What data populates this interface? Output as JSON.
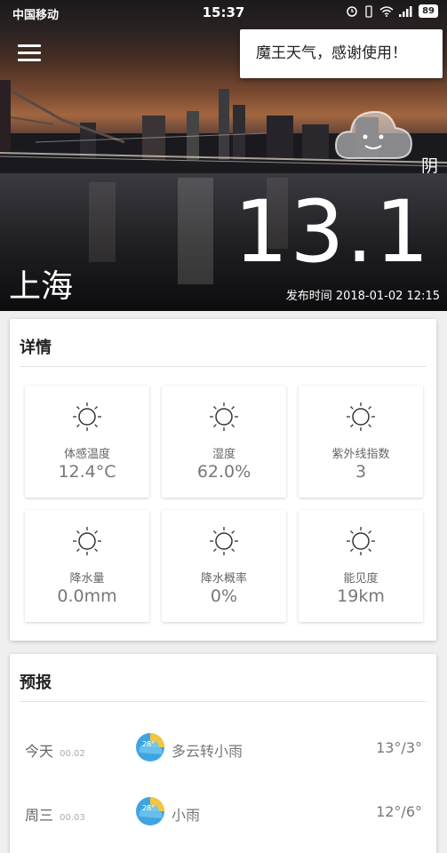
{
  "status_bar": {
    "carrier": "中国移动",
    "time": "15:37",
    "battery": "89"
  },
  "toast": {
    "message": "魔王天气，感谢使用！"
  },
  "current": {
    "condition": "阴",
    "temperature": "13.1",
    "city": "上海",
    "publish_label": "发布时间",
    "publish_time": "2018-01-02 12:15"
  },
  "details": {
    "title": "详情",
    "items": [
      {
        "label": "体感温度",
        "value": "12.4°C",
        "icon": "sun-icon"
      },
      {
        "label": "湿度",
        "value": "62.0%",
        "icon": "sun-icon"
      },
      {
        "label": "紫外线指数",
        "value": "3",
        "icon": "sun-icon"
      },
      {
        "label": "降水量",
        "value": "0.0mm",
        "icon": "sun-icon"
      },
      {
        "label": "降水概率",
        "value": "0%",
        "icon": "sun-icon"
      },
      {
        "label": "能见度",
        "value": "19km",
        "icon": "sun-icon"
      }
    ]
  },
  "forecast": {
    "title": "预报",
    "days": [
      {
        "day": "今天",
        "date": "00.02",
        "icon_text": "28°",
        "condition": "多云转小雨",
        "range": "13°/3°"
      },
      {
        "day": "周三",
        "date": "00.03",
        "icon_text": "28°",
        "condition": "小雨",
        "range": "12°/6°"
      }
    ]
  }
}
